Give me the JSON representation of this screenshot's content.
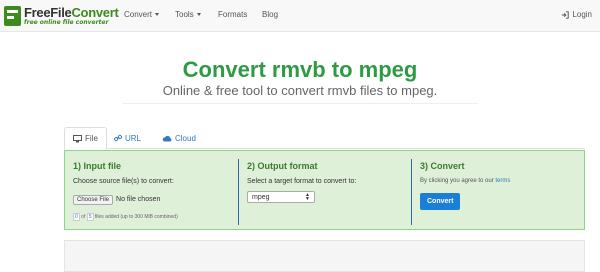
{
  "nav": {
    "brand_name_1": "FreeFile",
    "brand_name_2": "Convert",
    "brand_tagline": "free online file converter",
    "items": [
      {
        "label": "Convert",
        "has_caret": true
      },
      {
        "label": "Tools",
        "has_caret": true
      },
      {
        "label": "Formats",
        "has_caret": false
      },
      {
        "label": "Blog",
        "has_caret": false
      }
    ],
    "login_label": "Login",
    "login_icon": "login-icon"
  },
  "hero": {
    "title": "Convert rmvb to mpeg",
    "subtitle": "Online & free tool to convert rmvb files to mpeg."
  },
  "tabs": [
    {
      "label": "File",
      "icon": "monitor-icon",
      "active": true
    },
    {
      "label": "URL",
      "icon": "link-icon",
      "active": false
    },
    {
      "label": "Cloud",
      "icon": "cloud-icon",
      "active": false
    }
  ],
  "panel": {
    "input": {
      "heading": "1) Input file",
      "instruction": "Choose source file(s) to convert:",
      "choose_button": "Choose File",
      "no_file_text": "No file chosen",
      "count_current": "0",
      "count_of": "of",
      "count_max": "5",
      "count_note": "files added (up to 300 MiB combined)"
    },
    "output": {
      "heading": "2) Output format",
      "instruction": "Select a target format to convert to:",
      "selected_format": "mpeg"
    },
    "convert": {
      "heading": "3) Convert",
      "note_prefix": "By clicking you agree to our",
      "terms_link": "terms",
      "button_label": "Convert"
    }
  },
  "colors": {
    "title_green": "#2e9b44",
    "panel_bg": "#dff0d8",
    "panel_border": "#8fd48c",
    "convert_button": "#1c7fd6",
    "link_blue": "#337ab7"
  }
}
